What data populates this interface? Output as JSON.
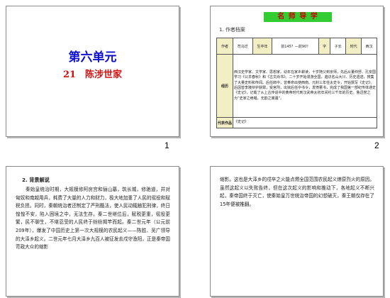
{
  "slides": [
    {
      "number": "1",
      "title": "第六单元",
      "subtitle": "21　陈涉世家"
    },
    {
      "number": "2",
      "banner": "名 师 导 学",
      "section": "1. 作者档案",
      "table": {
        "row1": [
          "作者",
          "司马迁",
          "生卒年",
          "前145？—前90？",
          "字",
          "子长",
          "时代",
          "西汉"
        ],
        "bio_label": "经历",
        "bio_text": "西汉史学家、文学家、思想家。幼年在家乡耕读，十岁随父到京师，先后从董仲舒、孔安国学习《公羊春秋》和《古文尚书》。二十岁开始漫游全国，遍访名山大川、历史遗迹，搜集了大量史料和传闻。后任郎中，曾奉命出使西南。元封三年任太史令，开始撰写《史记》。后因替李陵辩护获罪，受宫刑，出狱后任中书令，发愤著书，完成了我国第一部纪传体通史《史记》，记载了从上古传说中的黄帝时代到汉武帝太初年间约三千年的历史。鲁迅誉之为“史家之绝唱，无韵之离骚”。",
        "works_label": "代表作品",
        "works_text": "《史记》"
      }
    },
    {
      "number": "",
      "heading": "2. 背景解说",
      "paragraph": "秦始皇统治时期，大规模修阿房宫和骊山墓，筑长城，修驰道，并对匈奴和南越用兵，耗费了大量的人力和财力，极大地加重了人民的徭役和赋税负担。同时，秦朝统治者还制定了严刑酷法，使人民动辄触犯刑律，终日惶惶不安，陷入困境之中，无法生存。秦二世继位后，赋税更重，徭役更繁，民不聊生，不堪忍受的人民终于纷纷揭竿而起。秦二世元年（公元前209年），爆发了中国历史上第一次大规模的农民起义——陈胜、吴广领导的大泽乡起义。二世元年七月大泽乡九百人被征发去戍守渔阳，正是秦帝国苛政大众的缩影"
    },
    {
      "number": "",
      "paragraph": "缩影。这也是大泽乡的戍卒之火能点燃全国范围农民起义燎原烈火的原因。虽然这起义以失败告终，但在这次起义的影响和推动下，各地起义不断兴起，秦帝国终于灭亡，使秦始皇万世统治帝国的幻想破灭，秦王朝仅存在了15年便被推翻。"
    }
  ]
}
